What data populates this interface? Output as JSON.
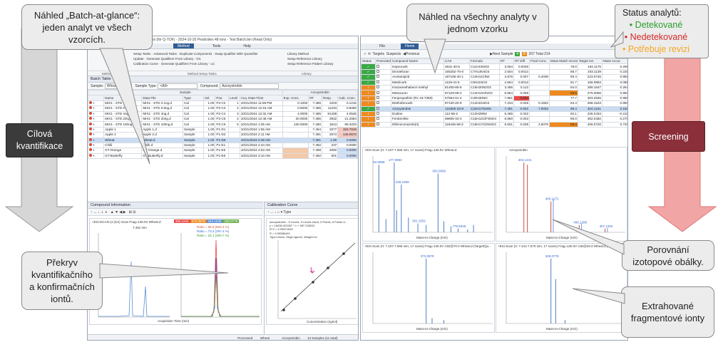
{
  "callouts": {
    "batch": "Náhled „Batch-at-glance“: jeden analyt ve všech vzorcích.",
    "overview": "Náhled na všechny analyty v jednom vzorku",
    "overlay": "Překryv kvantifikačního a konfirmačních iontů.",
    "isotope": "Porovnání izotopové obálky.",
    "fragments": "Extrahované fragmentové ionty"
  },
  "status_legend": {
    "title": "Status analytů:",
    "items": [
      {
        "label": "Detekované",
        "color": "#2ca02c"
      },
      {
        "label": "Nedetekované",
        "color": "#d62728"
      },
      {
        "label": "Potřebuje revizi",
        "color": "#f5a623"
      }
    ]
  },
  "arrows": {
    "left_label": "Cílová kvantifikace",
    "right_label": "Screening",
    "left_color": "#3b3b3b",
    "right_color": "#8b2f3a"
  },
  "quant_window": {
    "title": "der Quantitative Analysis (for Q-TOF) - 2024-10-20 Pesticides 48 ions - Test Batch.bin (Read Only)",
    "tabs": [
      "Method",
      "Tools",
      "Help"
    ],
    "active_tab": "Method",
    "ribbon": {
      "method_tasks": [
        "Setup Tasks",
        "Advanced Tasks",
        "Duplicate Components",
        "Swap Qualifier With Quantifier",
        "Generate Qualifiers From Library - GC",
        "Generate Qualifiers From Library - LC",
        "Update",
        "Calibration Curve"
      ],
      "library": [
        "Library Method",
        "Setup Reference Library",
        "Setup Reference Pattern Library"
      ],
      "group_method": "Method",
      "group_setup": "Method Setup Tasks",
      "group_library": "Library"
    },
    "batch_table": {
      "title": "Batch Table",
      "sample_filter": "Wheat",
      "sample_type": "<All>",
      "compound": "Azoxystrobin",
      "sample_header": "Sample",
      "azoxy_header": "Azoxystrobin",
      "columns": [
        "Name",
        "Data File",
        "Type",
        "Vol.",
        "Pos.",
        "Level",
        "Acq. Date-Time",
        "Exp. Conc.",
        "RT",
        "Resp.",
        "Calc. Conc."
      ],
      "rows": [
        [
          "MIX1 - STD 0.1ng.d",
          "MIX1 - STD 0.1ng.d",
          "Cal",
          "1.00",
          "P2-C2",
          "1",
          "10/21/2024 11:59 PM",
          "0.1000",
          "7.485",
          "2203",
          "0.1216"
        ],
        [
          "MIX1 - STD 0.5ng.d",
          "MIX1 - STD 0.5ng.d",
          "Cal",
          "1.00",
          "P2-C3",
          "2",
          "10/21/2024 12:15 AM",
          "0.5000",
          "7.485",
          "11234",
          "0.5093"
        ],
        [
          "MIX1 - STD 4ng.d",
          "MIX1 - STD 4ng.d",
          "Cal",
          "1.00",
          "P2-C4",
          "3",
          "10/21/2024 12:32 AM",
          "4.0000",
          "7.485",
          "91408",
          "4.0545"
        ],
        [
          "MIX1 - STD 20ng.d",
          "MIX1 - STD 20ng.d",
          "Cal",
          "1.00",
          "P2-C5",
          "4",
          "10/21/2024 12:48 AM",
          "20.0000",
          "7.485",
          "3932",
          "21.2584"
        ],
        [
          "MIX1 - STD 100ng.d",
          "MIX1 - STD 100ng.d",
          "Cal",
          "1.00",
          "P2-C6",
          "5",
          "10/21/2024 1:05 AM",
          "100.0000",
          "7.490",
          "1813",
          "99.3220"
        ],
        [
          "Apple 1",
          "Apple 1.d",
          "Sample",
          "1.00",
          "P1-D1",
          "",
          "10/21/2024 1:55 AM",
          "",
          "7.494",
          "3377",
          "183.7919"
        ],
        [
          "Apple 2",
          "Apple 2.d",
          "Sample",
          "1.00",
          "P1-D2",
          "",
          "10/21/2024 2:11 AM",
          "",
          "7.491",
          "2674",
          "145.0572"
        ],
        [
          "Wheat",
          "Wheat.d",
          "Sample",
          "1.00",
          "P1-D6",
          "",
          "10/21/2024 2:28 AM",
          "",
          "7.491",
          "1.00",
          "0.0000"
        ],
        [
          "Chilli",
          "Chilli.d",
          "Sample",
          "1.00",
          "P1-E1",
          "",
          "10/21/2024 2:44 AM",
          "",
          "7.492",
          "237",
          "0.0000"
        ],
        [
          "GT-Orange",
          "GT-Orange.d",
          "Sample",
          "1.00",
          "P1-E6",
          "",
          "10/21/2024 2:53 AM",
          "",
          "7.498",
          "2060",
          "0.0000"
        ],
        [
          "GT-Butterfly",
          "GT-Butterfly.d",
          "Sample",
          "1.00",
          "P1-E6",
          "",
          "10/21/2024 3:10 AM",
          "",
          "7.492",
          "601",
          "0.0000"
        ]
      ]
    },
    "compound_info": {
      "title": "Compound Information",
      "trace_label": "+ESI DCAN (4 (nm) Scan Frag=130.0V Wheat.d",
      "rt": "7.491 min",
      "ion_labels": [
        "404.1241",
        "372.0979",
        "344.1030",
        "329.0778"
      ],
      "ratios": [
        "Ratio = 56.9 (603.4 %)",
        "Ratio = 73.3 (297.4 %)",
        "Ratio = 22.1 (200.7 %)"
      ],
      "xlabel": "Acquisition Time (min)"
    },
    "calibration": {
      "title": "Calibration Curve",
      "lines": [
        "Azoxystrobin - 5 Levels, 5 Levels Used, 5 Points, 5 Points U...",
        "y = 18438.423367 * x + 987.236031",
        "R^2 = 0.99571639",
        "R = 0.99586449",
        "Type:Linear, Origin:Ignore, Weight:1/x"
      ],
      "xlabel": "Concentration (ng/ml)",
      "ylabel": "Responses"
    },
    "status_bar": [
      "Processed",
      "Wheat",
      "Azoxystrobin",
      "13 Samples (11 total)",
      "SYSTEM"
    ]
  },
  "screening_window": {
    "title": "Screening - [Result Review]",
    "tabs": [
      "File",
      "Home"
    ],
    "toolbar": [
      "Targets",
      "Suspects",
      "Previous",
      "Next Sample"
    ],
    "counts": [
      "4",
      "8",
      "207",
      "214"
    ],
    "count_labels": [
      "",
      "",
      "Total",
      ""
    ],
    "columns": [
      "Status",
      "Promoted",
      "Compound Name",
      "CAS",
      "Formula",
      "RT",
      "RT Diff",
      "Final Conc.",
      "Mass Match Score",
      "Target Ion",
      "Mass Accur."
    ],
    "rows": [
      {
        "status": "ok",
        "name": "Isoprocarb",
        "cas": "2631-40-5",
        "formula": "C11H15NO2",
        "rt": "3.054",
        "rtd": "0.0028",
        "conc": "",
        "score": "78.0",
        "ion": "194.1176",
        "acc": "0.296"
      },
      {
        "status": "ok",
        "name": "Dinotefuran",
        "cas": "165252-70-0",
        "formula": "C7H14N4O3",
        "rt": "2.504",
        "rtd": "0.0013",
        "conc": "",
        "score": "88.7",
        "ion": "203.1139",
        "acc": "0.220"
      },
      {
        "status": "ok",
        "name": "Acetamiprid",
        "cas": "187166-40-1",
        "formula": "C10H11ClN4",
        "rt": "3.876",
        "rtd": "0.007",
        "conc": "0.4039",
        "score": "90.4",
        "ion": "223.0745",
        "acc": "0.950"
      },
      {
        "status": "ok",
        "name": "Metolcarb",
        "cas": "1129-41-5",
        "formula": "C9H11NO2",
        "rt": "2.664",
        "rtd": "0.0013",
        "conc": "",
        "score": "81.7",
        "ion": "166.0863",
        "acc": "0.088"
      },
      {
        "status": "rev",
        "name": "Imazamethabenz-methyl",
        "cas": "81405-85-8",
        "formula": "C16H20N2O3",
        "rt": "3.495",
        "rtd": "0.112",
        "conc": "",
        "score": "84.0",
        "ion": "289.1547",
        "acc": "0.264"
      },
      {
        "status": "rev",
        "name": "Metoxuron",
        "cas": "67129-08-2",
        "formula": "C14H14ClNO3",
        "rt": "6.854",
        "rtd": "0.008",
        "conc": "",
        "score": "69.6",
        "ion": "279.3066",
        "acc": "0.950"
      },
      {
        "status": "rev",
        "name": "Fenpropathrin (Rc 19-7359)",
        "cas": "67564-91-4",
        "formula": "C20H30NO",
        "rt": "7.961",
        "rtd": "0.664",
        "conc": "",
        "score": "77.7",
        "ion": "303.2845",
        "acc": "0.950"
      },
      {
        "status": "rev",
        "name": "Diethofencarb",
        "cas": "87130-20-9",
        "formula": "C14H21NO4",
        "rt": "7.234",
        "rtd": "0.028",
        "conc": "0.1822",
        "score": "84.4",
        "ion": "268.1543",
        "acc": "0.950"
      },
      {
        "status": "ok",
        "name": "Azoxystrobin",
        "cas": "131860-33-8",
        "formula": "C22H17N3O5",
        "rt": "7.491",
        "rtd": "0.002",
        "conc": "7.0033",
        "score": "99.4",
        "ion": "404.1241",
        "acc": "0.150"
      },
      {
        "status": "rev",
        "name": "Dodine",
        "cas": "112-65-2",
        "formula": "C13H29N3",
        "rt": "6.465",
        "rtd": "0.032",
        "conc": "",
        "score": "92.1",
        "ion": "228.2434",
        "acc": "-0.210"
      },
      {
        "status": "rev",
        "name": "Fenbenthie",
        "cas": "69806-34-4",
        "formula": "C15H12ClF3NO4",
        "rt": "8.860",
        "rtd": "0.003",
        "conc": "",
        "score": "90.0",
        "ion": "362.0492",
        "acc": "0.270"
      },
      {
        "status": "rev",
        "name": "Difenoconazole(II)",
        "cas": "119446-68-3",
        "formula": "C19H17Cl2N3O3",
        "rt": "9.601",
        "rtd": "0.039",
        "conc": "2.6078",
        "score": "59.4",
        "ion": "406.0720",
        "acc": "0.720"
      }
    ],
    "spec_titles": [
      "+ESI Scan (rt: 7.437-7.566 min, 17 scans) Frag=130.0V Wheat.d",
      "Azoxystrobin",
      "+ESI Scan (rt: 7.437-7.566 min, 17 scans) Frag=130.0V CID@70.0 Wheat.d (Target/Qu...",
      "+ESI Scan (rt: 7.441-7.570 min, 17 scans) Frag=130.0V CID@40.0 Wheat.d (Target/Qu..."
    ],
    "spec_labels": {
      "a_peaks": [
        "94.0858",
        "177.0893",
        "228.1959",
        "363.0096",
        "361.1652",
        "779.5345"
      ],
      "b_peaks": [
        "404.1241",
        "405.1272",
        "406.1298",
        "407.1334"
      ],
      "c_peaks": [
        "372.0979"
      ],
      "d_peaks": [
        "329.0778"
      ]
    },
    "x_axis_label": "Mass-to-Charge (m/z)",
    "y_axis_label": "Counts"
  }
}
